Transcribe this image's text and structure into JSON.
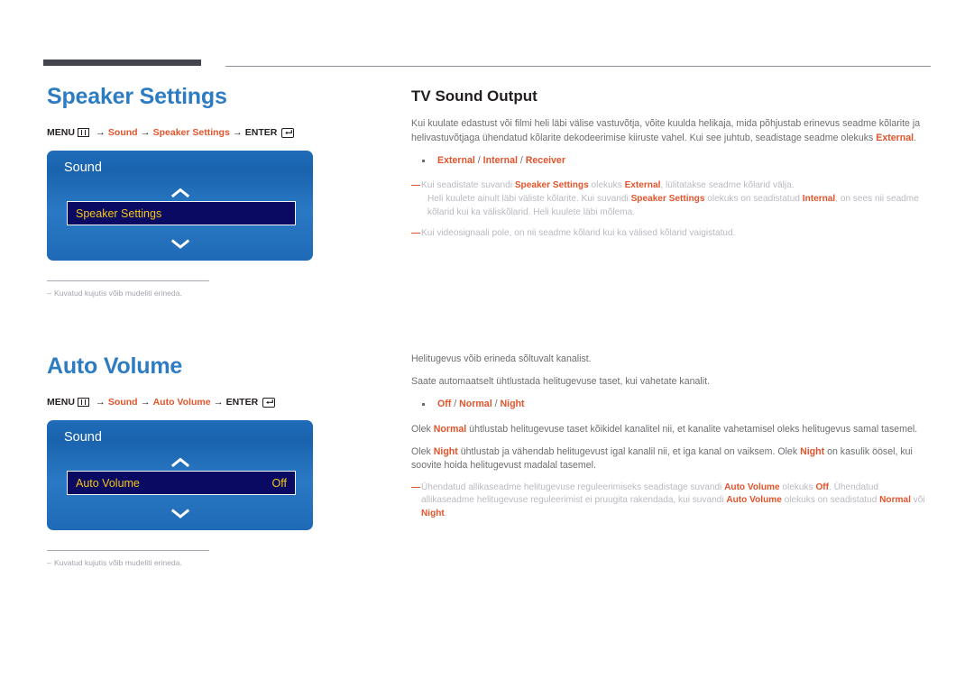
{
  "page": {
    "language": "et",
    "accent_color": "#e2542c",
    "heading_color": "#2d7cc2",
    "body_color": "#6d6e71"
  },
  "sections": [
    {
      "id": "speaker-settings",
      "title": "Speaker Settings",
      "menu_path": {
        "menu_label": "MENU",
        "menu_icon": "menu-grid-icon",
        "arrow": "→",
        "steps": [
          "Sound",
          "Speaker Settings"
        ],
        "enter_label": "ENTER",
        "enter_icon": "enter-key-icon"
      },
      "osd": {
        "title": "Sound",
        "up_icon": "chevron-up-icon",
        "down_icon": "chevron-down-icon",
        "row_label": "Speaker Settings",
        "row_value": ""
      },
      "footnote_dash": "–",
      "footnote": "Kuvatud kujutis võib mudeliti erineda."
    },
    {
      "id": "auto-volume",
      "title": "Auto Volume",
      "menu_path": {
        "menu_label": "MENU",
        "menu_icon": "menu-grid-icon",
        "arrow": "→",
        "steps": [
          "Sound",
          "Auto Volume"
        ],
        "enter_label": "ENTER",
        "enter_icon": "enter-key-icon"
      },
      "osd": {
        "title": "Sound",
        "up_icon": "chevron-up-icon",
        "down_icon": "chevron-down-icon",
        "row_label": "Auto Volume",
        "row_value": "Off"
      },
      "footnote_dash": "–",
      "footnote": "Kuvatud kujutis võib mudeliti erineda."
    }
  ],
  "right": {
    "tv_sound_output": {
      "title": "TV Sound Output",
      "intro_part1": "Kui kuulate edastust või filmi heli läbi välise vastuvõtja, võite kuulda helikaja, mida põhjustab erinevus seadme kõlarite ja helivastuvõtjaga ühendatud kõlarite dekodeerimise kiiruste vahel. Kui see juhtub, seadistage seadme olekuks ",
      "intro_hl": "External",
      "intro_part2": ".",
      "options": [
        {
          "value": "External",
          "sep": " / "
        },
        {
          "value": "Internal",
          "sep": " / "
        },
        {
          "value": "Receiver",
          "sep": ""
        }
      ],
      "notes": [
        {
          "dash": "—",
          "lines": [
            {
              "indent": false,
              "runs": [
                {
                  "t": "Kui seadistate suvandi ",
                  "hl": false
                },
                {
                  "t": "Speaker Settings",
                  "hl": true
                },
                {
                  "t": " olekuks ",
                  "hl": false
                },
                {
                  "t": "External",
                  "hl": true
                },
                {
                  "t": ", lülitatakse seadme kõlarid välja.",
                  "hl": false
                }
              ]
            },
            {
              "indent": true,
              "runs": [
                {
                  "t": "Heli kuulete ainult läbi väliste kõlarite. Kui suvandi ",
                  "hl": false
                },
                {
                  "t": "Speaker Settings",
                  "hl": true
                },
                {
                  "t": " olekuks on seadistatud ",
                  "hl": false
                },
                {
                  "t": "Internal",
                  "hl": true
                },
                {
                  "t": ", on sees nii seadme kõlarid kui ka väliskõlarid. Heli kuulete läbi mõlema.",
                  "hl": false
                }
              ]
            }
          ]
        },
        {
          "dash": "—",
          "lines": [
            {
              "indent": false,
              "runs": [
                {
                  "t": "Kui videosignaali pole, on nii seadme kõlarid kui ka välised kõlarid vaigistatud.",
                  "hl": false
                }
              ]
            }
          ]
        }
      ]
    },
    "auto_volume": {
      "para1": "Helitugevus võib erineda sõltuvalt kanalist.",
      "para2": "Saate automaatselt ühtlustada helitugevuse taset, kui vahetate kanalit.",
      "options": [
        {
          "value": "Off",
          "sep": " / "
        },
        {
          "value": "Normal",
          "sep": " / "
        },
        {
          "value": "Night",
          "sep": ""
        }
      ],
      "para3_runs": [
        {
          "t": "Olek ",
          "hl": false
        },
        {
          "t": "Normal",
          "hl": true
        },
        {
          "t": " ühtlustab helitugevuse taset kõikidel kanalitel nii, et kanalite vahetamisel oleks helitugevus samal tasemel.",
          "hl": false
        }
      ],
      "para4_runs": [
        {
          "t": "Olek ",
          "hl": false
        },
        {
          "t": "Night",
          "hl": true
        },
        {
          "t": " ühtlustab ja vähendab helitugevust igal kanalil nii, et iga kanal on vaiksem. Olek ",
          "hl": false
        },
        {
          "t": "Night",
          "hl": true
        },
        {
          "t": " on kasulik öösel, kui soovite hoida helitugevust madalal tasemel.",
          "hl": false
        }
      ],
      "notes": [
        {
          "dash": "—",
          "lines": [
            {
              "indent": false,
              "runs": [
                {
                  "t": "Ühendatud allikaseadme helitugevuse reguleerimiseks seadistage suvandi ",
                  "hl": false
                },
                {
                  "t": "Auto Volume",
                  "hl": true
                },
                {
                  "t": " olekuks ",
                  "hl": false
                },
                {
                  "t": "Off",
                  "hl": true
                },
                {
                  "t": ". Ühendatud allikaseadme helitugevuse reguleerimist ei pruugita rakendada, kui suvandi ",
                  "hl": false
                },
                {
                  "t": "Auto Volume",
                  "hl": true
                },
                {
                  "t": " olekuks on seadistatud ",
                  "hl": false
                },
                {
                  "t": "Normal",
                  "hl": true
                },
                {
                  "t": " või ",
                  "hl": false
                },
                {
                  "t": "Night",
                  "hl": true
                },
                {
                  "t": ".",
                  "hl": false
                }
              ]
            }
          ]
        }
      ]
    }
  }
}
